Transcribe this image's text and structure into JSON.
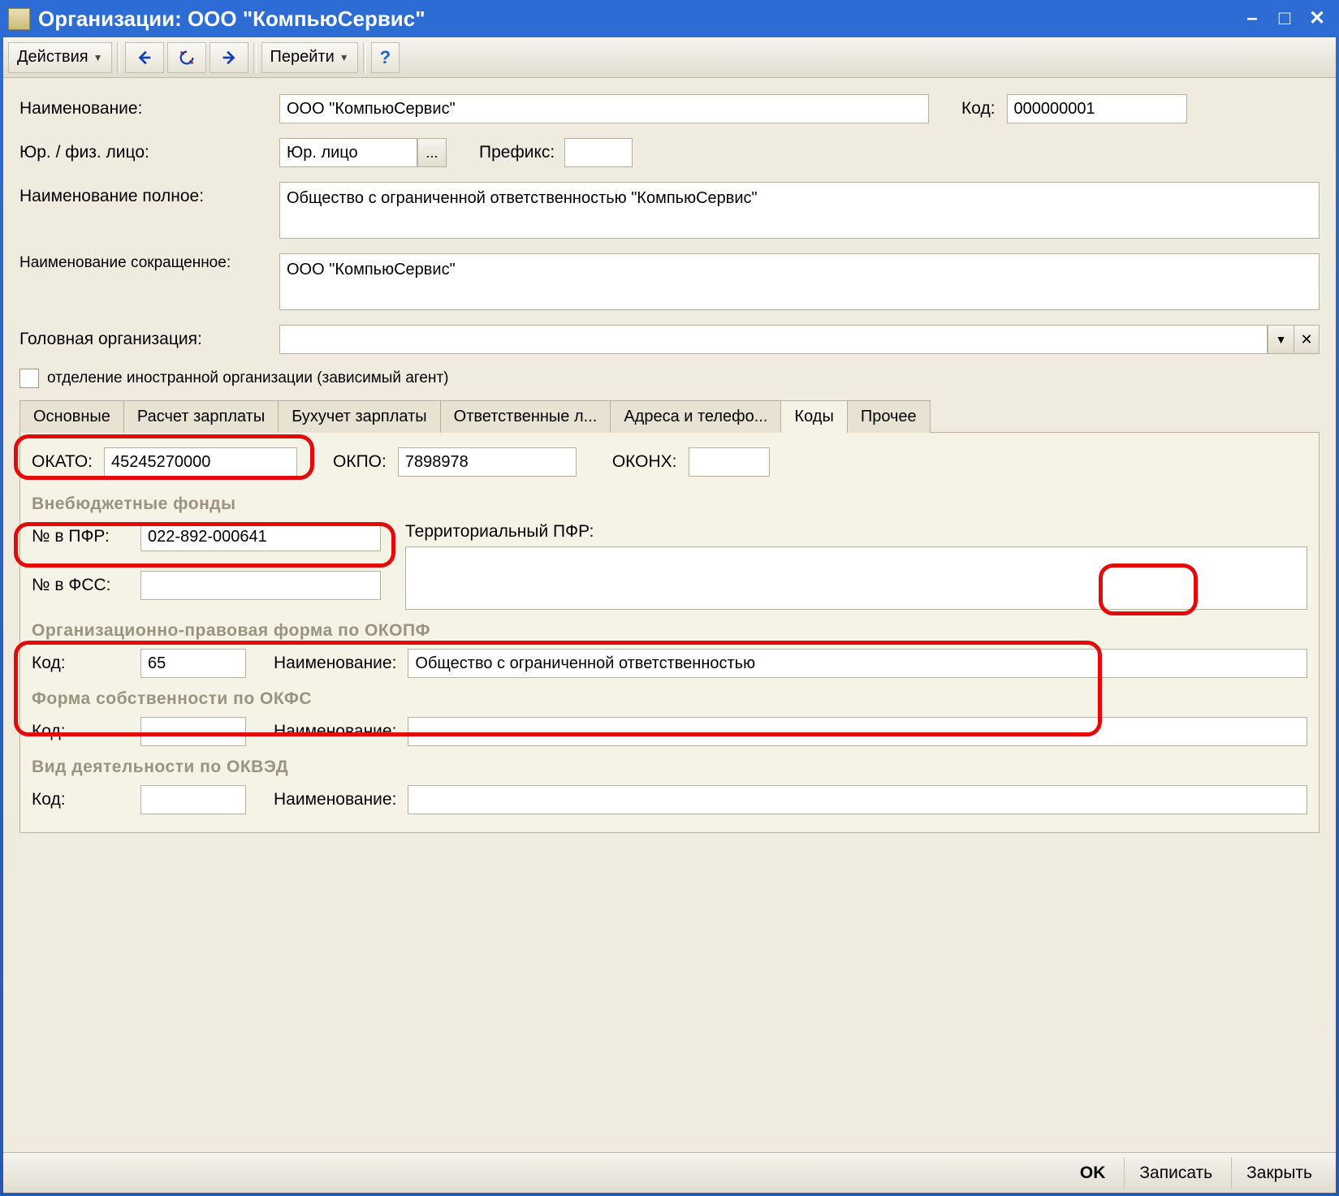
{
  "window": {
    "title": "Организации: ООО \"КомпьюСервис\""
  },
  "toolbar": {
    "actions_label": "Действия",
    "goto_label": "Перейти",
    "help_label": "?"
  },
  "fields": {
    "name_label": "Наименование:",
    "name_value": "ООО \"КомпьюСервис\"",
    "code_label": "Код:",
    "code_value": "000000001",
    "entity_label": "Юр. / физ. лицо:",
    "entity_value": "Юр. лицо",
    "entity_picker": "...",
    "prefix_label": "Префикс:",
    "prefix_value": "",
    "full_label": "Наименование полное:",
    "full_value": "Общество с ограниченной ответственностью \"КомпьюСервис\"",
    "short_label": "Наименование сокращенное:",
    "short_value": "ООО \"КомпьюСервис\"",
    "parent_label": "Головная организация:",
    "parent_value": "",
    "foreign_branch_label": "отделение иностранной организации (зависимый агент)"
  },
  "tabs": {
    "t0": "Основные",
    "t1": "Расчет зарплаты",
    "t2": "Бухучет зарплаты",
    "t3": "Ответственные л...",
    "t4": "Адреса и телефо...",
    "t5": "Коды",
    "t6": "Прочее"
  },
  "codes": {
    "okato_label": "ОКАТО:",
    "okato_value": "45245270000",
    "okpo_label": "ОКПО:",
    "okpo_value": "7898978",
    "okonh_label": "ОКОНХ:",
    "okonh_value": "",
    "funds_group": "Внебюджетные фонды",
    "pfr_num_label": "№ в ПФР:",
    "pfr_num_value": "022-892-000641",
    "pfr_terr_label": "Территориальный ПФР:",
    "pfr_terr_value": "",
    "fss_num_label": "№ в ФСС:",
    "fss_num_value": "",
    "okopf_group": "Организационно-правовая форма по ОКОПФ",
    "okopf_code_label": "Код:",
    "okopf_code_value": "65",
    "okopf_name_label": "Наименование:",
    "okopf_name_value": "Общество с ограниченной ответственностью",
    "okfs_group": "Форма собственности по ОКФС",
    "okfs_code_label": "Код:",
    "okfs_code_value": "",
    "okfs_name_label": "Наименование:",
    "okfs_name_value": "",
    "okved_group": "Вид деятельности по ОКВЭД",
    "okved_code_label": "Код:",
    "okved_code_value": "",
    "okved_name_label": "Наименование:",
    "okved_name_value": ""
  },
  "footer": {
    "ok": "OK",
    "save": "Записать",
    "close": "Закрыть"
  }
}
